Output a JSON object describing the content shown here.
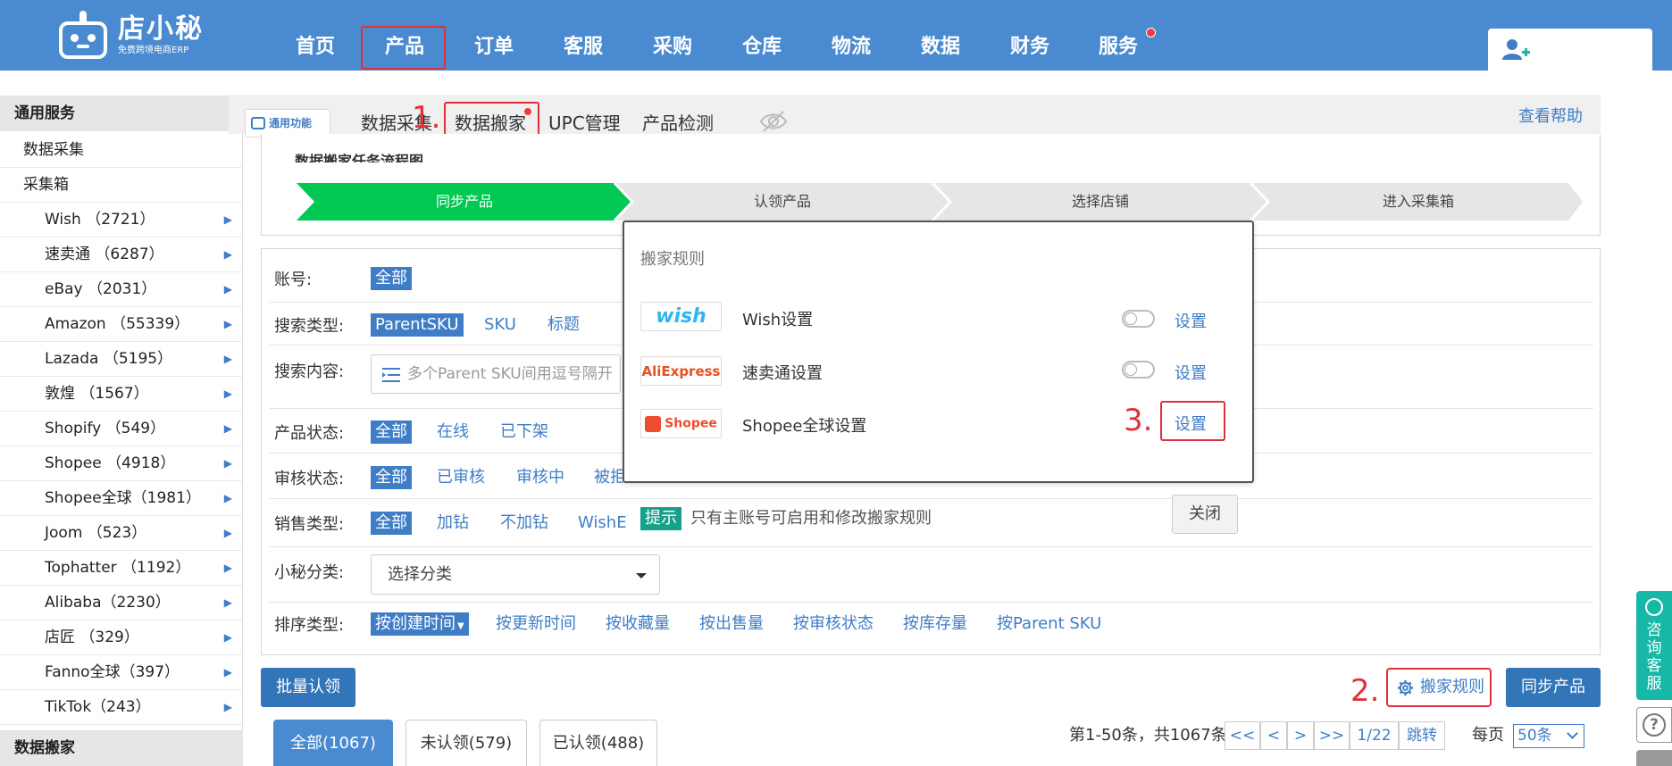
{
  "brand": {
    "name": "店小秘",
    "tagline": "免费跨境电商ERP"
  },
  "nav": {
    "items": [
      "首页",
      "产品",
      "订单",
      "客服",
      "采购",
      "仓库",
      "物流",
      "数据",
      "财务",
      "服务"
    ],
    "active": "产品"
  },
  "sidebar": {
    "section1": "通用服务",
    "data_collect": "数据采集",
    "collect_box": "采集箱",
    "platforms": [
      "Wish （2721）",
      "速卖通 （6287）",
      "eBay （2031）",
      "Amazon （55339）",
      "Lazada （5195）",
      "敦煌 （1567）",
      "Shopify （549）",
      "Shopee （4918）",
      "Shopee全球（1981）",
      "Joom （523）",
      "Tophatter （1192）",
      "Alibaba（2230）",
      "店匠 （329）",
      "Fanno全球（397）",
      "TikTok（243）"
    ],
    "section2": "数据搬家"
  },
  "subtabs": {
    "common_function": "通用功能",
    "tabs": [
      "数据采集",
      "数据搬家",
      "UPC管理",
      "产品检测"
    ],
    "help": "查看帮助"
  },
  "annotations": {
    "one": "1.",
    "two": "2.",
    "three": "3."
  },
  "flow": {
    "title": "数据搬家任务流程图",
    "steps": [
      "同步产品",
      "认领产品",
      "选择店铺",
      "进入采集箱"
    ]
  },
  "filters": {
    "account_label": "账号:",
    "account_selected": "全部",
    "search_type_label": "搜索类型:",
    "search_type_selected": "ParentSKU",
    "search_type_options": [
      "SKU",
      "标题"
    ],
    "search_content_label": "搜索内容:",
    "search_placeholder": "多个Parent SKU间用逗号隔开",
    "product_status_label": "产品状态:",
    "product_status_selected": "全部",
    "product_status_options": [
      "在线",
      "已下架"
    ],
    "review_status_label": "审核状态:",
    "review_status_selected": "全部",
    "review_status_options": [
      "已审核",
      "审核中",
      "被拒"
    ],
    "sale_type_label": "销售类型:",
    "sale_type_selected": "全部",
    "sale_type_options": [
      "加钻",
      "不加钻",
      "WishE"
    ],
    "category_label": "小秘分类:",
    "category_placeholder": "选择分类",
    "sort_label": "排序类型:",
    "sort_selected": "按创建时间",
    "sort_options": [
      "按更新时间",
      "按收藏量",
      "按出售量",
      "按审核状态",
      "按库存量",
      "按Parent SKU"
    ]
  },
  "popup": {
    "title": "搬家规则",
    "rules": [
      {
        "logo": "wish",
        "name": "Wish设置",
        "action": "设置"
      },
      {
        "logo": "AliExpress",
        "name": "速卖通设置",
        "action": "设置"
      },
      {
        "logo": "Shopee",
        "name": "Shopee全球设置",
        "action": "设置"
      }
    ],
    "tip_badge": "提示",
    "tip_text": "只有主账号可启用和修改搬家规则",
    "close": "关闭"
  },
  "actions": {
    "batch_claim": "批量认领",
    "move_rules": "搬家规则",
    "sync_products": "同步产品"
  },
  "bottom_tabs": [
    "全部(1067)",
    "未认领(579)",
    "已认领(488)"
  ],
  "pagination": {
    "info": "第1-50条，共1067条",
    "first": "<<",
    "prev": "<",
    "next": ">",
    "last": ">>",
    "page": "1/22",
    "jump": "跳转",
    "per_page_label": "每页",
    "per_page_value": "50条"
  },
  "consult": "咨询客服",
  "help_mark": "?",
  "colors": {
    "brand_blue": "#4a8ad0",
    "link_blue": "#3f7dc6",
    "flow_green": "#00c853",
    "annotation_red": "#e0303a",
    "tip_green": "#18a08a"
  }
}
